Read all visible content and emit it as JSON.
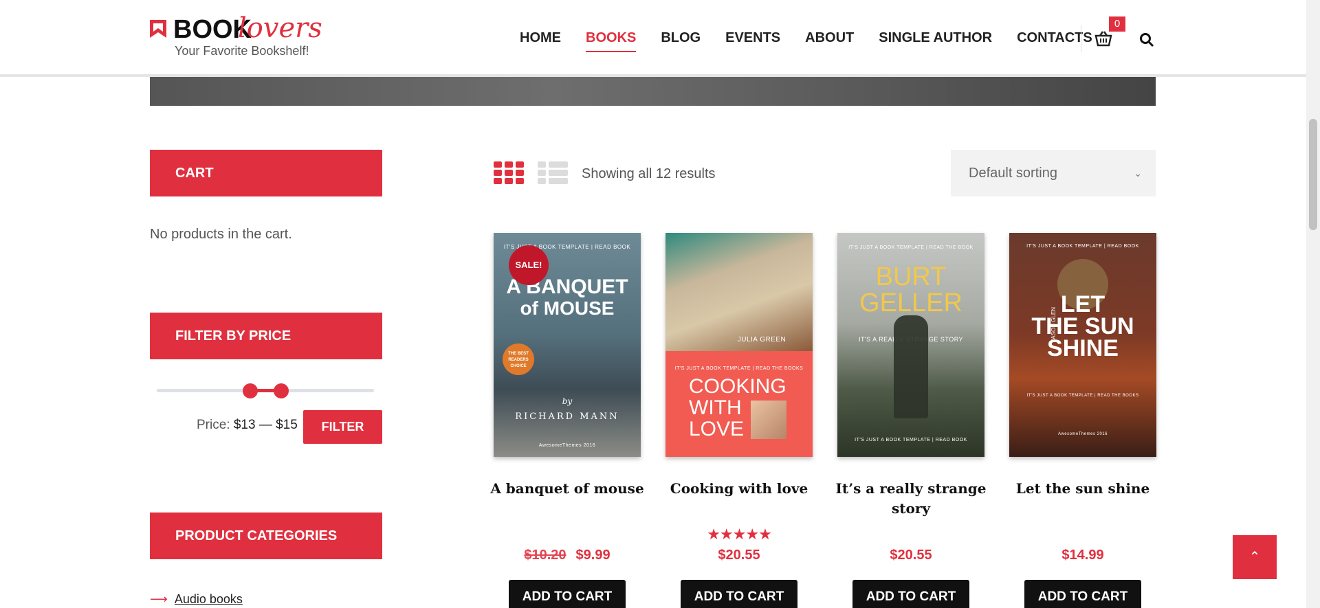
{
  "logo": {
    "brand_a": "BOOK",
    "brand_b": "lovers",
    "tagline": "Your Favorite Bookshelf!"
  },
  "nav": {
    "items": [
      {
        "label": "HOME",
        "active": false
      },
      {
        "label": "BOOKS",
        "active": true
      },
      {
        "label": "BLOG",
        "active": false
      },
      {
        "label": "EVENTS",
        "active": false
      },
      {
        "label": "ABOUT",
        "active": false
      },
      {
        "label": "SINGLE AUTHOR",
        "active": false
      },
      {
        "label": "CONTACTS",
        "active": false
      }
    ],
    "cart_count": "0"
  },
  "sidebar": {
    "cart_title": "CART",
    "cart_empty": "No products in the cart.",
    "filter_title": "FILTER BY PRICE",
    "price_prefix": "Price:",
    "price_range": "$13 — $15",
    "filter_button": "FILTER",
    "categories_title": "PRODUCT CATEGORIES",
    "categories": [
      {
        "label": "Audio books"
      }
    ]
  },
  "toolbar": {
    "results": "Showing all 12 results",
    "sorting": "Default sorting"
  },
  "products": [
    {
      "title": "A banquet of mouse",
      "old_price": "$10.20",
      "price": "$9.99",
      "sale": "SALE!",
      "rating": "",
      "button": "ADD TO CART",
      "cover": {
        "top": "IT'S JUST A BOOK TEMPLATE  |  READ BOOK",
        "line1": "A BANQUET",
        "line2": "of MOUSE",
        "badge": "THE BEST READERS CHOICE",
        "by": "by",
        "author": "RICHARD MANN",
        "foot": "AwesomeThemes 2016"
      }
    },
    {
      "title": "Cooking with love",
      "old_price": "",
      "price": "$20.55",
      "sale": "",
      "rating": "★★★★★",
      "button": "ADD TO CART",
      "cover": {
        "author": "JULIA GREEN",
        "top": "IT'S JUST A BOOK TEMPLATE  |  READ THE BOOKS",
        "line1": "COOKING",
        "line2": "WITH",
        "line3": "LOVE"
      }
    },
    {
      "title": "It’s a really strange story",
      "old_price": "",
      "price": "$20.55",
      "sale": "",
      "rating": "",
      "button": "ADD TO CART",
      "cover": {
        "top": "IT'S JUST A BOOK TEMPLATE  |  READ THE BOOK",
        "line1": "BURT",
        "line2": "GELLER",
        "sub": "IT'S A REALLY STRANGE STORY",
        "foot": "IT'S JUST A BOOK TEMPLATE  |  READ BOOK"
      }
    },
    {
      "title": "Let the sun shine",
      "old_price": "",
      "price": "$14.99",
      "sale": "",
      "rating": "",
      "button": "ADD TO CART",
      "cover": {
        "top": "IT'S JUST A BOOK TEMPLATE  |  READ BOOK",
        "side": "JASON GLEN",
        "line1": "LET",
        "line2": "THE SUN",
        "line3": "SHINE",
        "sub": "IT'S JUST A BOOK TEMPLATE  |  READ THE BOOKS",
        "foot": "AwesomeThemes 2016"
      }
    }
  ],
  "colors": {
    "accent": "#e0303f",
    "dark": "#111111"
  },
  "icons": {
    "cart": "cart-icon",
    "search": "search-icon",
    "grid": "grid-view-icon",
    "list": "list-view-icon",
    "back_to_top": "chevron-up-icon"
  }
}
